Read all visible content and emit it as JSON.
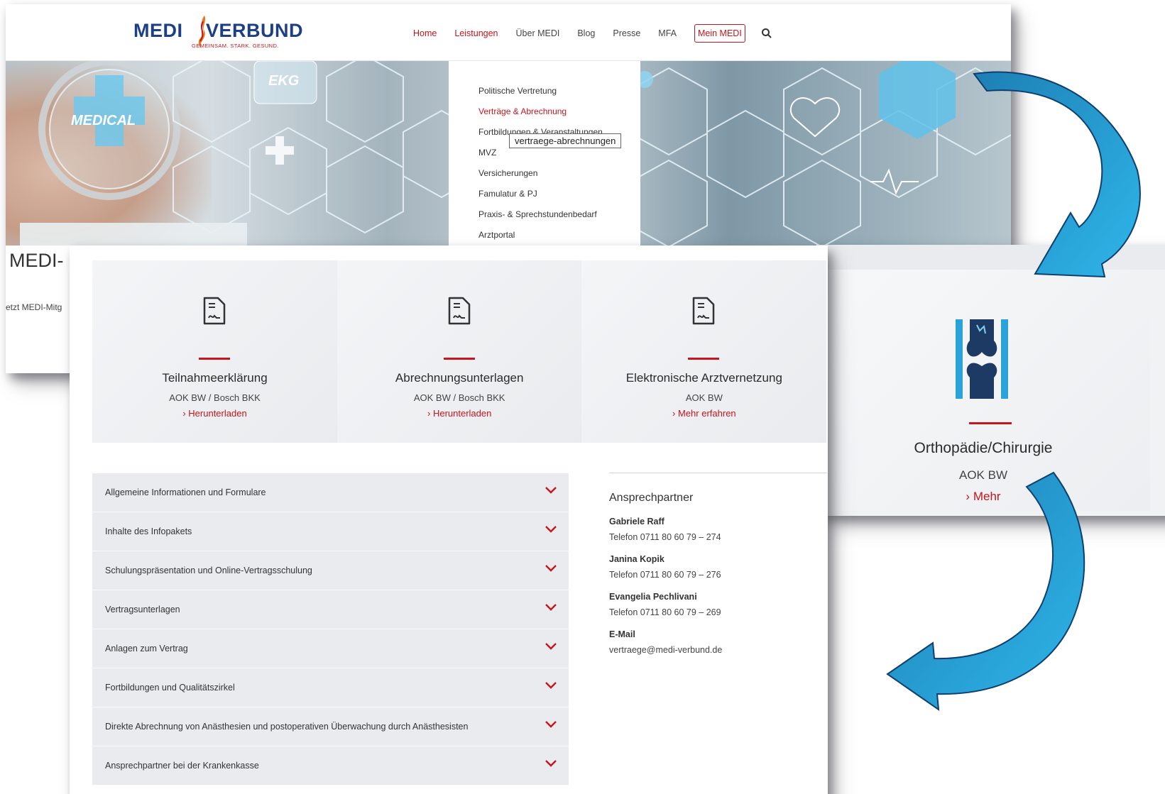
{
  "header": {
    "logo_left": "MEDI",
    "logo_right": "VERBUND",
    "logo_tagline": "GEMEINSAM. STARK. GESUND.",
    "nav": [
      {
        "label": "Home",
        "active": true
      },
      {
        "label": "Leistungen",
        "active": true
      },
      {
        "label": "Über MEDI",
        "active": false
      },
      {
        "label": "Blog",
        "active": false
      },
      {
        "label": "Presse",
        "active": false
      },
      {
        "label": "MFA",
        "active": false
      }
    ],
    "mein_medi": "Mein MEDI",
    "search_icon": "search-icon"
  },
  "dropdown": {
    "items": [
      {
        "label": "Politische Vertretung",
        "active": false
      },
      {
        "label": "Verträge & Abrechnung",
        "active": true
      },
      {
        "label": "Fortbildungen & Veranstaltungen",
        "active": false
      },
      {
        "label": "MVZ",
        "active": false
      },
      {
        "label": "Versicherungen",
        "active": false
      },
      {
        "label": "Famulatur & PJ",
        "active": false
      },
      {
        "label": "Praxis- & Sprechstundenbedarf",
        "active": false
      },
      {
        "label": "Arztportal",
        "active": false
      }
    ],
    "tooltip": "vertraege-abrechnungen"
  },
  "hero": {
    "title_partial": "MEDI-",
    "subtitle_partial": "etzt MEDI-Mitg",
    "labels": [
      "MEDICAL",
      "EKG"
    ]
  },
  "side_card": {
    "icon": "knee-bone-icon",
    "title": "Orthopädie/Chirurgie",
    "subtitle": "AOK BW",
    "link": "Mehr"
  },
  "download_cards": [
    {
      "icon": "document-icon",
      "title": "Teilnahmeerklärung",
      "subtitle": "AOK BW / Bosch BKK",
      "link": "Herunterladen"
    },
    {
      "icon": "document-icon",
      "title": "Abrechnungsunterlagen",
      "subtitle": "AOK BW / Bosch BKK",
      "link": "Herunterladen"
    },
    {
      "icon": "document-icon",
      "title": "Elektronische Arztvernetzung",
      "subtitle": "AOK BW",
      "link": "Mehr erfahren"
    }
  ],
  "accordion": [
    "Allgemeine Informationen und Formulare",
    "Inhalte des Infopakets",
    "Schulungspräsentation und Online-Vertragsschulung",
    "Vertragsunterlagen",
    "Anlagen zum Vertrag",
    "Fortbildungen und Qualitätszirkel",
    "Direkte Abrechnung von Anästhesien und postoperativen Überwachung durch Anästhesisten",
    "Ansprechpartner bei der Krankenkasse"
  ],
  "contact": {
    "heading": "Ansprechpartner",
    "people": [
      {
        "name": "Gabriele Raff",
        "phone": "Telefon 0711 80 60 79 – 274"
      },
      {
        "name": "Janina Kopik",
        "phone": "Telefon 0711 80 60 79 – 276"
      },
      {
        "name": "Evangelia Pechlivani",
        "phone": "Telefon 0711 80 60 79 – 269"
      }
    ],
    "email_label": "E-Mail",
    "email": "vertraege@medi-verbund.de"
  },
  "colors": {
    "brand_red": "#c4161c",
    "brand_blue": "#1d3f87",
    "arrow_blue": "#1fa6dc",
    "card_bg": "#eceef1"
  }
}
